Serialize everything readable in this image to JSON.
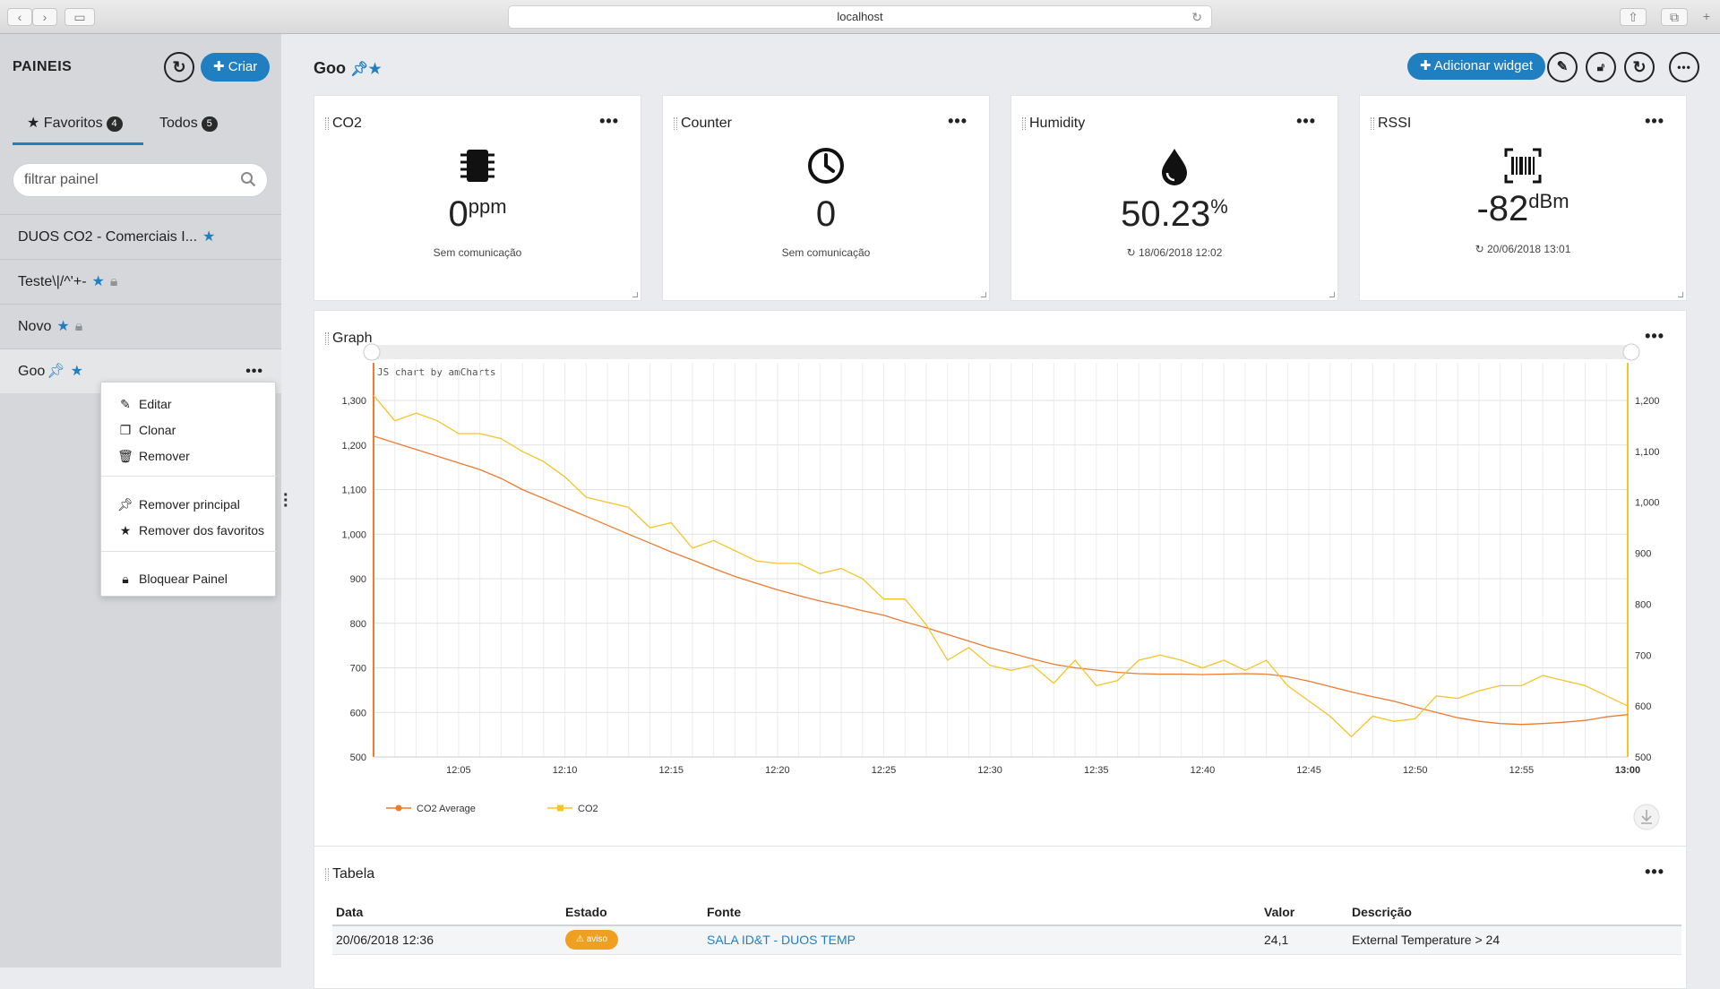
{
  "browser": {
    "url": "localhost"
  },
  "sidebar": {
    "title": "PAINEIS",
    "create_label": "Criar",
    "tabs": [
      {
        "label": "Favoritos",
        "count": "4"
      },
      {
        "label": "Todos",
        "count": "5"
      }
    ],
    "search_placeholder": "filtrar painel",
    "items": [
      {
        "label": "DUOS CO2 - Comerciais I..."
      },
      {
        "label": "Teste\\|/^'+-"
      },
      {
        "label": "Novo"
      },
      {
        "label": "Goo"
      }
    ],
    "context_menu": [
      {
        "label": "Editar",
        "icon": "pencil-icon"
      },
      {
        "label": "Clonar",
        "icon": "copy-icon"
      },
      {
        "label": "Remover",
        "icon": "trash-icon"
      },
      {
        "label": "Remover principal",
        "icon": "pin-icon"
      },
      {
        "label": "Remover dos favoritos",
        "icon": "star-icon"
      },
      {
        "label": "Bloquear Painel",
        "icon": "lock-icon"
      }
    ]
  },
  "header": {
    "title": "Goo",
    "add_widget_label": "Adicionar widget"
  },
  "widgets": [
    {
      "title": "CO2",
      "value": "0",
      "unit": "ppm",
      "sub": "Sem comunicação",
      "icon": "chip-icon"
    },
    {
      "title": "Counter",
      "value": "0",
      "unit": "",
      "sub": "Sem comunicação",
      "icon": "clock-icon"
    },
    {
      "title": "Humidity",
      "value": "50.23",
      "unit": "%",
      "sub": "18/06/2018 12:02",
      "icon": "drop-icon"
    },
    {
      "title": "RSSI",
      "value": "-82",
      "unit": "dBm",
      "sub": "20/06/2018 13:01",
      "icon": "barcode-icon"
    }
  ],
  "graph": {
    "title": "Graph",
    "credit": "JS chart by amCharts"
  },
  "chart_data": {
    "type": "line",
    "x": [
      "12:01",
      "12:02",
      "12:03",
      "12:04",
      "12:05",
      "12:06",
      "12:07",
      "12:08",
      "12:09",
      "12:10",
      "12:11",
      "12:12",
      "12:13",
      "12:14",
      "12:15",
      "12:16",
      "12:17",
      "12:18",
      "12:19",
      "12:20",
      "12:21",
      "12:22",
      "12:23",
      "12:24",
      "12:25",
      "12:26",
      "12:27",
      "12:28",
      "12:29",
      "12:30",
      "12:31",
      "12:32",
      "12:33",
      "12:34",
      "12:35",
      "12:36",
      "12:37",
      "12:38",
      "12:39",
      "12:40",
      "12:41",
      "12:42",
      "12:43",
      "12:44",
      "12:45",
      "12:46",
      "12:47",
      "12:48",
      "12:49",
      "12:50",
      "12:51",
      "12:52",
      "12:53",
      "12:54",
      "12:55",
      "12:56",
      "12:57",
      "12:58",
      "12:59",
      "13:00"
    ],
    "x_ticks": [
      "12:05",
      "12:10",
      "12:15",
      "12:20",
      "12:25",
      "12:30",
      "12:35",
      "12:40",
      "12:45",
      "12:50",
      "12:55",
      "13:00"
    ],
    "series": [
      {
        "name": "CO2 Average",
        "color": "#f07a30",
        "axis": "left",
        "values": [
          1220,
          1205,
          1190,
          1175,
          1160,
          1145,
          1125,
          1100,
          1080,
          1060,
          1040,
          1020,
          1000,
          980,
          960,
          942,
          923,
          905,
          890,
          875,
          862,
          850,
          840,
          828,
          818,
          803,
          790,
          775,
          760,
          745,
          733,
          720,
          708,
          700,
          695,
          690,
          687,
          686,
          686,
          685,
          686,
          687,
          686,
          680,
          670,
          658,
          646,
          635,
          625,
          612,
          600,
          588,
          580,
          575,
          573,
          575,
          578,
          582,
          590,
          595
        ]
      },
      {
        "name": "CO2",
        "color": "#f5c428",
        "axis": "right",
        "values": [
          1210,
          1160,
          1175,
          1160,
          1135,
          1135,
          1125,
          1100,
          1080,
          1050,
          1010,
          1000,
          990,
          950,
          960,
          910,
          925,
          905,
          885,
          880,
          880,
          860,
          870,
          850,
          810,
          810,
          760,
          690,
          715,
          680,
          670,
          680,
          645,
          690,
          640,
          650,
          690,
          700,
          690,
          675,
          690,
          670,
          690,
          640,
          610,
          580,
          540,
          580,
          570,
          575,
          620,
          615,
          630,
          640,
          640,
          660,
          650,
          640,
          620,
          600
        ]
      }
    ],
    "ylim_left": [
      500,
      1300
    ],
    "ylim_right": [
      500,
      1200
    ],
    "y_ticks_left": [
      "500",
      "600",
      "700",
      "800",
      "900",
      "1,000",
      "1,100",
      "1,200",
      "1,300"
    ],
    "y_ticks_right": [
      "500",
      "600",
      "700",
      "800",
      "900",
      "1,000",
      "1,100",
      "1,200"
    ],
    "grid": true,
    "legend": "bottom-left"
  },
  "table": {
    "title": "Tabela",
    "columns": [
      "Data",
      "Estado",
      "Fonte",
      "Valor",
      "Descrição"
    ],
    "rows": [
      {
        "data": "20/06/2018 12:36",
        "estado": "aviso",
        "fonte": "SALA ID&T - DUOS TEMP",
        "valor": "24,1",
        "descricao": "External Temperature > 24"
      }
    ]
  }
}
